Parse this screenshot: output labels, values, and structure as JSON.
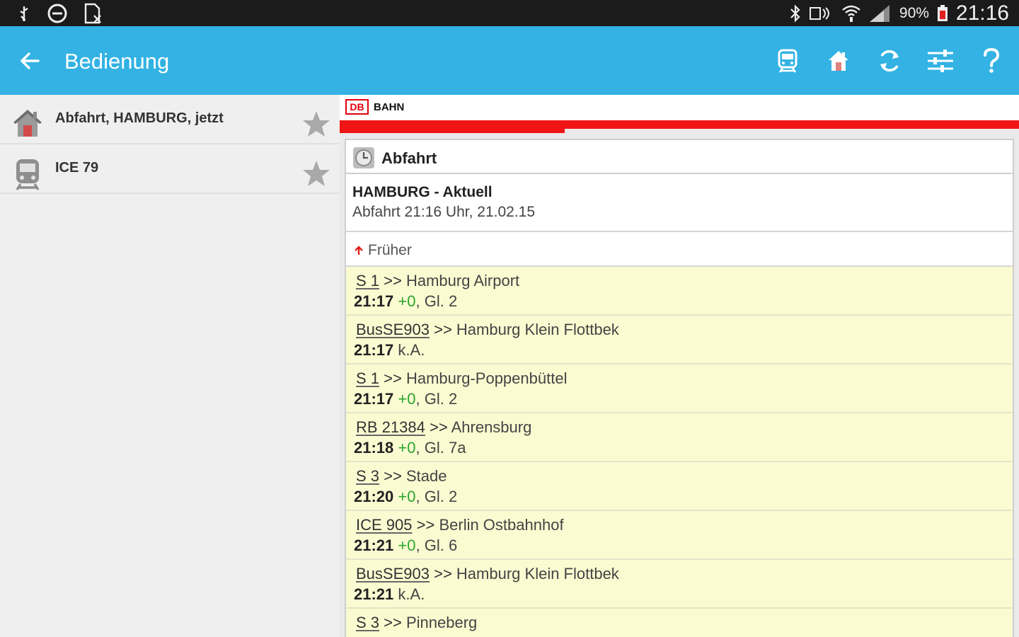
{
  "status_bar": {
    "left_icons": [
      "usb-icon",
      "do-not-disturb-icon",
      "file-icon"
    ],
    "right_icons": [
      "bluetooth-icon",
      "nfc-icon",
      "wifi-icon",
      "signal-icon"
    ],
    "battery": "90%",
    "time": "21:16"
  },
  "action_bar": {
    "title": "Bedienung",
    "back_icon": "arrow-left-icon",
    "actions": [
      "train-icon",
      "home-icon",
      "refresh-icon",
      "settings-sliders-icon",
      "help-icon"
    ]
  },
  "favorites": [
    {
      "label": "Abfahrt, HAMBURG, jetzt",
      "icon": "home-icon"
    },
    {
      "label": "ICE 79",
      "icon": "train-icon"
    }
  ],
  "db": {
    "logo": "DB",
    "name": "BAHN"
  },
  "board": {
    "header": "Abfahrt",
    "station": "HAMBURG - Aktuell",
    "time_info": "Abfahrt 21:16 Uhr, 21.02.15",
    "earlier": "Früher",
    "rows": [
      {
        "train": "S 1",
        "sep": ">>",
        "dest": "Hamburg Airport",
        "time": "21:17",
        "delay": "+0",
        "platform": "Gl. 2"
      },
      {
        "train": "BusSE903",
        "sep": ">>",
        "dest": "Hamburg Klein Flottbek",
        "time": "21:17",
        "delay": "",
        "platform": "k.A."
      },
      {
        "train": "S 1",
        "sep": ">>",
        "dest": "Hamburg-Poppenbüttel",
        "time": "21:17",
        "delay": "+0",
        "platform": "Gl. 2"
      },
      {
        "train": "RB 21384",
        "sep": ">>",
        "dest": "Ahrensburg",
        "time": "21:18",
        "delay": "+0",
        "platform": "Gl. 7a"
      },
      {
        "train": "S 3",
        "sep": ">>",
        "dest": "Stade",
        "time": "21:20",
        "delay": "+0",
        "platform": "Gl. 2"
      },
      {
        "train": "ICE 905",
        "sep": ">>",
        "dest": "Berlin Ostbahnhof",
        "time": "21:21",
        "delay": "+0",
        "platform": "Gl. 6"
      },
      {
        "train": "BusSE903",
        "sep": ">>",
        "dest": "Hamburg Klein Flottbek",
        "time": "21:21",
        "delay": "",
        "platform": "k.A."
      },
      {
        "train": "S 3",
        "sep": ">>",
        "dest": "Pinneberg",
        "time": "",
        "delay": "",
        "platform": ""
      }
    ]
  },
  "colors": {
    "action_bar": "#33b2e3",
    "db_red": "#f01414",
    "row_bg": "#fbfbd2",
    "delay_green": "#2ea52e"
  }
}
